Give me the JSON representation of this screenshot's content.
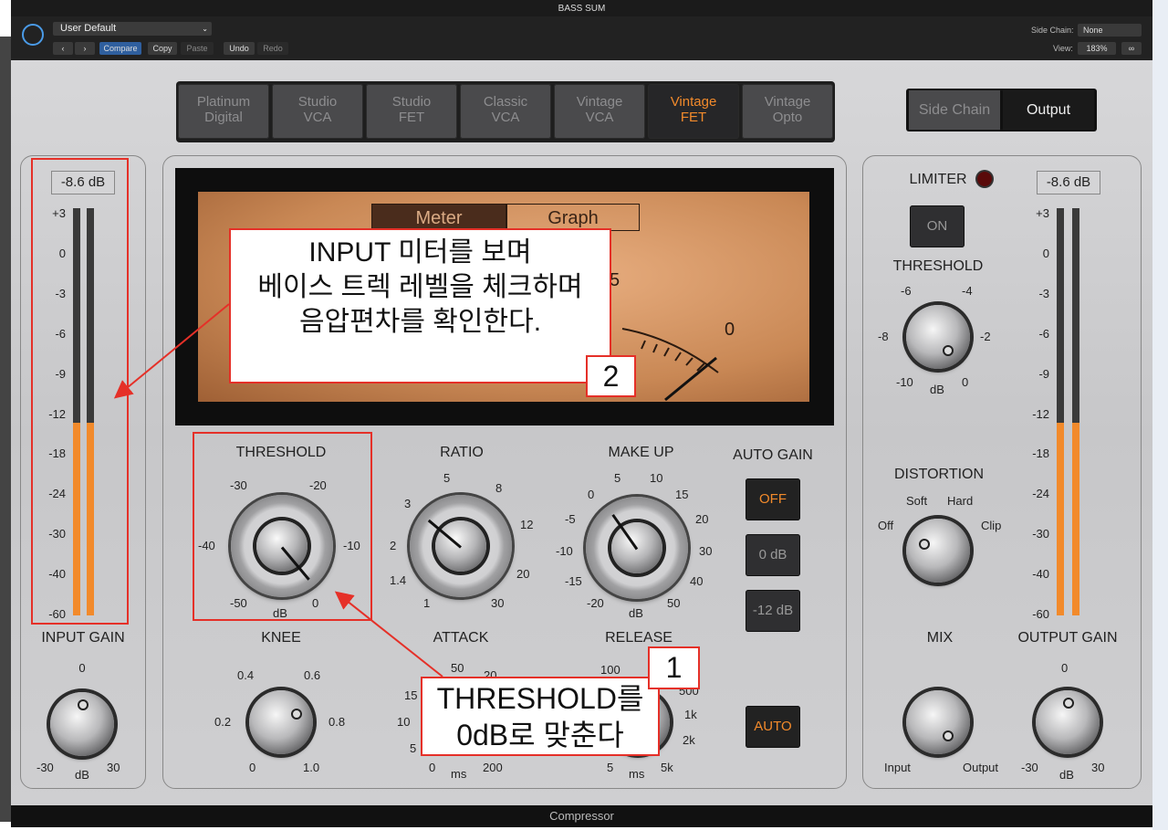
{
  "window": {
    "title": "BASS SUM",
    "footer": "Compressor"
  },
  "header": {
    "preset": "User Default",
    "compare": "Compare",
    "copy": "Copy",
    "paste": "Paste",
    "undo": "Undo",
    "redo": "Redo",
    "side_chain_label": "Side Chain:",
    "side_chain_value": "None",
    "view_label": "View:",
    "view_value": "183%"
  },
  "models": [
    {
      "line1": "Platinum",
      "line2": "Digital"
    },
    {
      "line1": "Studio",
      "line2": "VCA"
    },
    {
      "line1": "Studio",
      "line2": "FET"
    },
    {
      "line1": "Classic",
      "line2": "VCA"
    },
    {
      "line1": "Vintage",
      "line2": "VCA"
    },
    {
      "line1": "Vintage",
      "line2": "FET"
    },
    {
      "line1": "Vintage",
      "line2": "Opto"
    }
  ],
  "selected_model": "Vintage FET",
  "output_toggle": {
    "side_chain": "Side Chain",
    "output": "Output"
  },
  "input_meter": {
    "readout": "-8.6 dB",
    "scale": [
      "+3",
      "0",
      "-3",
      "-6",
      "-9",
      "-12",
      "-18",
      "-24",
      "-30",
      "-40",
      "-60"
    ],
    "level_fraction": 0.47
  },
  "output_meter": {
    "readout": "-8.6 dB",
    "scale": [
      "+3",
      "0",
      "-3",
      "-6",
      "-9",
      "-12",
      "-18",
      "-24",
      "-30",
      "-40",
      "-60"
    ],
    "level_fraction": 0.47
  },
  "input_gain": {
    "label": "INPUT GAIN",
    "ticks": [
      "0",
      "-30",
      "dB",
      "30"
    ]
  },
  "output_gain": {
    "label": "OUTPUT GAIN",
    "ticks": [
      "0",
      "-30",
      "dB",
      "30"
    ]
  },
  "display": {
    "tab_meter": "Meter",
    "tab_graph": "Graph",
    "scale_5": "5",
    "scale_0": "0"
  },
  "threshold": {
    "label": "THRESHOLD",
    "ticks": [
      "-30",
      "-20",
      "-40",
      "-10",
      "-50",
      "dB",
      "0"
    ]
  },
  "ratio": {
    "label": "RATIO",
    "ticks": [
      "5",
      "8",
      "3",
      "12",
      "2",
      "20",
      "1.4",
      "1",
      "30"
    ]
  },
  "makeup": {
    "label": "MAKE UP",
    "ticks": [
      "5",
      "10",
      "0",
      "15",
      "-5",
      "20",
      "-10",
      "30",
      "-15",
      "40",
      "-20",
      "dB",
      "50"
    ]
  },
  "auto_gain": {
    "label": "AUTO GAIN",
    "off": "OFF",
    "zero": "0 dB",
    "minus12": "-12 dB"
  },
  "knee": {
    "label": "KNEE",
    "ticks": [
      "0.4",
      "0.6",
      "0.2",
      "0.8",
      "0",
      "1.0"
    ]
  },
  "attack": {
    "label": "ATTACK",
    "ticks": [
      "50",
      "20",
      "15",
      "10",
      "5",
      "0",
      "ms",
      "200"
    ]
  },
  "release": {
    "label": "RELEASE",
    "ticks": [
      "100",
      "500",
      "1k",
      "2k",
      "5",
      "ms",
      "5k"
    ]
  },
  "auto_button": "AUTO",
  "limiter": {
    "label": "LIMITER",
    "on": "ON",
    "threshold_label": "THRESHOLD",
    "ticks": [
      "-6",
      "-4",
      "-8",
      "-2",
      "-10",
      "dB",
      "0"
    ]
  },
  "distortion": {
    "label": "DISTORTION",
    "ticks": [
      "Soft",
      "Hard",
      "Off",
      "Clip"
    ]
  },
  "mix": {
    "label": "MIX",
    "input": "Input",
    "output": "Output"
  },
  "callouts": {
    "c2_line1": "INPUT 미터를 보며",
    "c2_line2": "베이스 트렉 레벨을 체크하며",
    "c2_line3": "음압편차를 확인한다.",
    "c2_num": "2",
    "c1_line1": "THRESHOLD를",
    "c1_line2": "0dB로 맞춘다",
    "c1_num": "1"
  },
  "colors": {
    "accent": "#f28a2b",
    "annotation": "#e53028",
    "panel": "#cdcdcf",
    "dark": "#222222"
  }
}
